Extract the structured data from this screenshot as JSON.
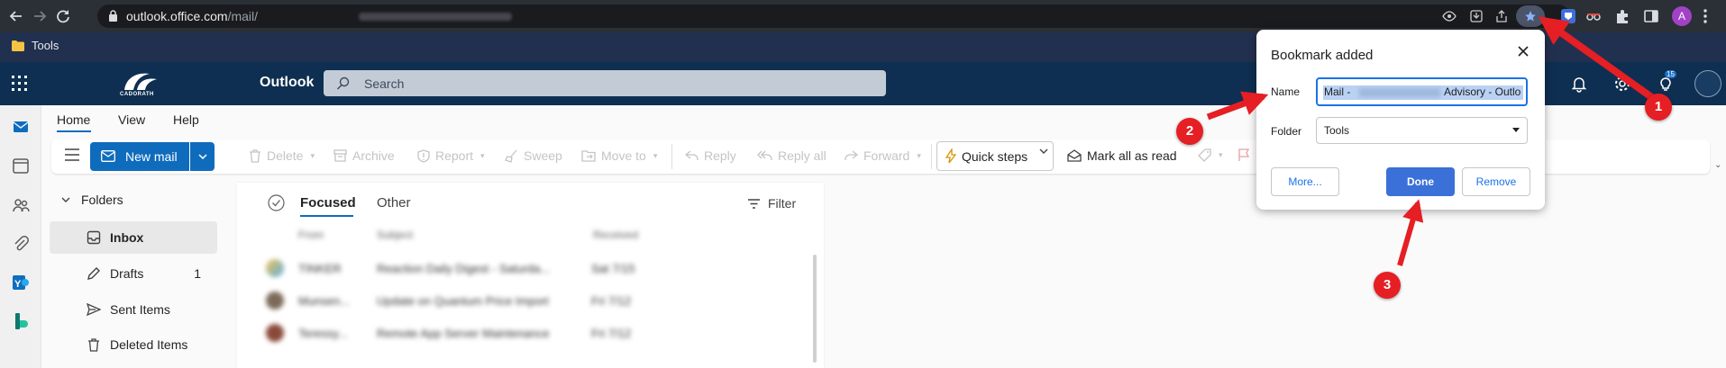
{
  "browser": {
    "url_host": "outlook.office.com",
    "url_path": "/mail/",
    "profile_initial": "A",
    "bookmark_folder": "Tools"
  },
  "outlook": {
    "app_name": "Outlook",
    "logo_text": "CADORATH",
    "search_placeholder": "Search",
    "tips_badge": "15",
    "ribbon_tabs": [
      "Home",
      "View",
      "Help"
    ],
    "new_mail": "New mail",
    "commands": {
      "delete": "Delete",
      "archive": "Archive",
      "report": "Report",
      "sweep": "Sweep",
      "move_to": "Move to",
      "reply": "Reply",
      "reply_all": "Reply all",
      "forward": "Forward",
      "quick_steps": "Quick steps",
      "mark_all_read": "Mark all as read"
    },
    "folders_header": "Folders",
    "folders": [
      {
        "name": "Inbox",
        "count": ""
      },
      {
        "name": "Drafts",
        "count": "1"
      },
      {
        "name": "Sent Items",
        "count": ""
      },
      {
        "name": "Deleted Items",
        "count": ""
      }
    ],
    "list_tabs": {
      "focused": "Focused",
      "other": "Other"
    },
    "filter_label": "Filter",
    "columns": {
      "from": "From",
      "subject": "Subject",
      "received": "Received"
    },
    "messages": [
      {
        "from": "TINKER",
        "subject": "Reaction Daily Digest - Saturda...",
        "date": "Sat 7/15"
      },
      {
        "from": "Munsen...",
        "subject": "Update on Quantum Price Import",
        "date": "Fri 7/12"
      },
      {
        "from": "Teressy...",
        "subject": "Remote App Server Maintenance",
        "date": "Fri 7/12"
      }
    ]
  },
  "bookmark_dialog": {
    "title": "Bookmark added",
    "name_label": "Name",
    "name_value_start": "Mail -",
    "name_value_end": "Advisory - Outlo",
    "folder_label": "Folder",
    "folder_value": "Tools",
    "more_button": "More...",
    "done_button": "Done",
    "remove_button": "Remove"
  },
  "annotations": [
    "1",
    "2",
    "3"
  ],
  "colors": {
    "chrome_dark": "#2b2f36",
    "bookmark_bar": "#22304f",
    "outlook_header": "#0e2f51",
    "accent_blue": "#0f6cbd",
    "annotation_red": "#e51f24"
  }
}
